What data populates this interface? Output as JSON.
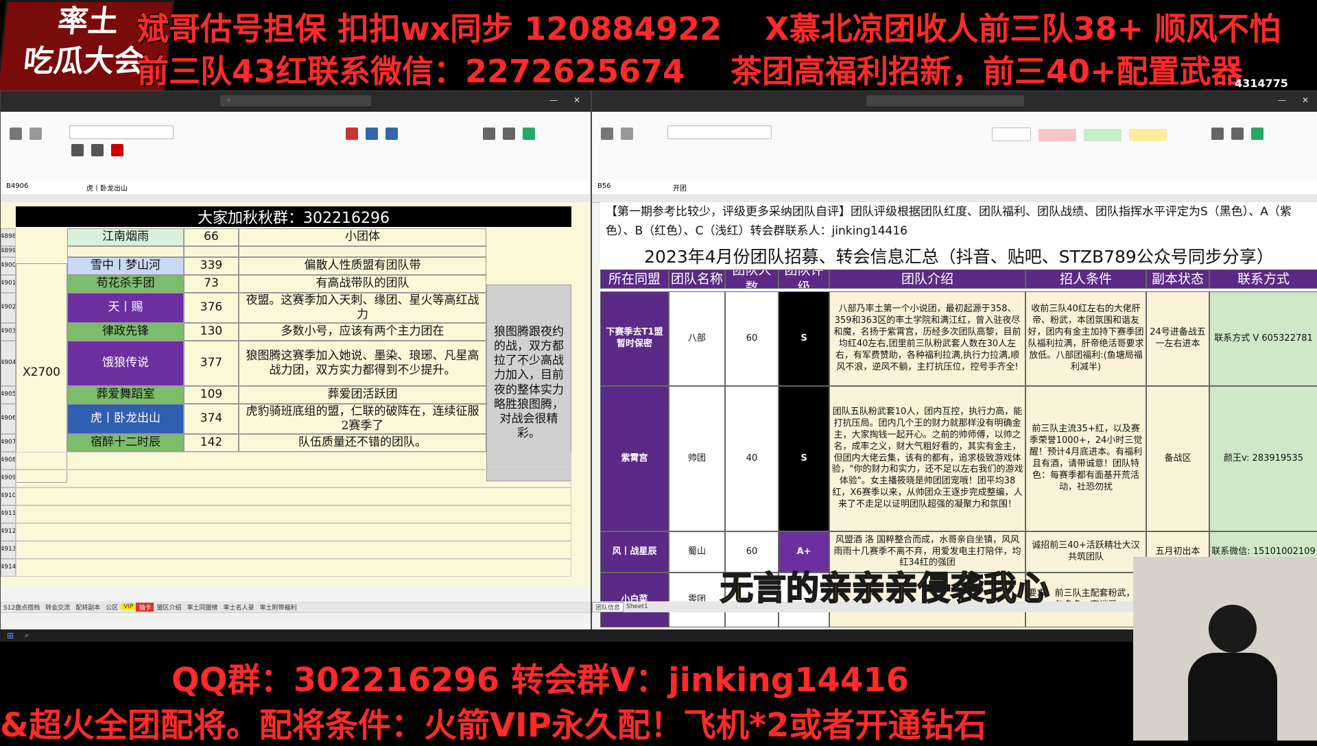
{
  "banner": {
    "line1_a": "斌哥估号担保 扣扣wx同步 120884922",
    "line1_b": "X慕北凉团收人前三队38+  顺风不怕",
    "line2_a": "前三队43红联系微信：2272625674",
    "line2_b": "茶团高福利招新，前三40+配置武器"
  },
  "logo": {
    "line1": "率土",
    "line2": "吃瓜大会"
  },
  "stream_counter": "4314775",
  "left_sheet": {
    "title": "大家加秋秋群：302216296",
    "name_box": "B4906",
    "formula": "虎丨卧龙出山",
    "group_label": "X2700",
    "rows": [
      {
        "row": "4898",
        "name": "江南烟雨",
        "count": "66",
        "desc": "小团体",
        "name_color": "#d9f0d9"
      },
      {
        "row": "4899",
        "name": "",
        "count": "",
        "desc": "",
        "name_color": ""
      },
      {
        "row": "4900",
        "name": "雪中丨梦山河",
        "count": "339",
        "desc": "偏散人性质盟有团队带",
        "name_color": "#c9d8f5"
      },
      {
        "row": "4901",
        "name": "苟花杀手团",
        "count": "73",
        "desc": "有高战带队的团队",
        "name_color": "#7cbc6a"
      },
      {
        "row": "4902",
        "name": "天丨赐",
        "count": "376",
        "desc": "夜盟。这赛季加入天刺、缘团、星火等高红战力",
        "name_color": "#6b2fa0"
      },
      {
        "row": "4903",
        "name": "律政先锋",
        "count": "130",
        "desc": "多数小号，应该有两个主力团在",
        "name_color": "#7cbc6a"
      },
      {
        "row": "4904",
        "name": "饿狼传说",
        "count": "377",
        "desc": "狼图腾这赛季加入她说、墨染、琅琊、凡星高战力团，双方实力都得到不少提升。",
        "name_color": "#6b2fa0"
      },
      {
        "row": "4905",
        "name": "葬爱舞蹈室",
        "count": "109",
        "desc": "葬爱团活跃团",
        "name_color": "#7cbc6a"
      },
      {
        "row": "4906",
        "name": "虎丨卧龙出山",
        "count": "374",
        "desc": "虎豹骑班底组的盟，仁联的破阵在，连续征服2赛季了",
        "name_color": "#2f5fb0"
      },
      {
        "row": "4907",
        "name": "宿醉十二时辰",
        "count": "142",
        "desc": "队伍质量还不错的团队。",
        "name_color": "#7cbc6a"
      }
    ],
    "side_note": "狼图腾跟夜约的战，双方都拉了不少高战力加入，目前夜的整体实力略胜狼图腾，对战会很精彩。",
    "empty_rows": [
      "4908",
      "4909",
      "4910",
      "4911",
      "4912",
      "4913",
      "4914"
    ],
    "tabs": [
      "S12盘点搭档",
      "转会交流",
      "配将副本",
      "公区",
      "VIP",
      "抽卡",
      "盟区介绍",
      "率土同盟榜",
      "率土名人录",
      "率土附带福利"
    ]
  },
  "right_sheet": {
    "name_box": "B56",
    "formula": "开团",
    "notice": "【第一期参考比较少，评级更多采纳团队自评】团队评级根据团队红度、团队福利、团队战绩、团队指挥水平评定为S（黑色）、A（紫色）、B（红色）、C（浅红）转会群联系人：jinking14416",
    "title": "2023年4月份团队招募、转会信息汇总（抖音、贴吧、STZB789公众号同步分享）",
    "headers": [
      "所在同盟",
      "团队名称",
      "团队人数",
      "团队评级",
      "团队介绍",
      "招人条件",
      "副本状态",
      "联系方式"
    ],
    "rows": [
      {
        "alliance": "下赛季去T1盟 暂时保密",
        "team": "八部",
        "size": "60",
        "grade": "S",
        "intro": "八部乃率土第一个小说团，最初起源于358、359和363区的率土学院和满江红，曾入驻夜尽和魔，名扬于紫霄宫，历经多次团队高黎，目前均红40左右,团里前三队粉武套人数在30人左右，有军费赞助，各种福利拉满,执行力拉满,顺风不浪，逆风不躺，主打抗压位，控号手齐全!",
        "req": "收前三队40红左右的大佬肝帝、粉武，本团氛围和谐友好，团内有金主加持下赛季团队福利拉满，肝帝绝活哥要求放低。八部团福利:(鱼塘局福利减半)",
        "status": "24号进备战五一左右进本",
        "contact": "联系方式 V 605322781"
      },
      {
        "alliance": "紫霄宫",
        "team": "帅团",
        "size": "40",
        "grade": "S",
        "intro": "团队五队粉武套10人，团内互控，执行力高，能打抗压局。团内几个王的财力就那样没有明确金主，大家掏钱一起开心。之前的帅师傅，以帅之名，成率之义，财大气粗好看的，其实有金主，但团内大佬云集，该有的都有，追求极致游戏体验，\"你的财力和实力，还不足以左右我们的游戏体验\"。女主播筱晓是帅团团宠哦！团平均38红，X6赛季以来，从帅团众王逐步完成整编，人来了不走足以证明团队超强的凝聚力和氛围！",
        "req": "前三队主流35+红，以及赛季荣誉1000+，24小时三觉醒！预计4月底进本。有福利且有酒，请带诚意！团队特色：每赛季都有面基开荒活动，社恐勿扰",
        "status": "备战区",
        "contact": "颜王v: 283919535"
      },
      {
        "alliance": "风丨战星辰",
        "team": "蜀山",
        "size": "60",
        "grade": "A+",
        "intro": "风盟酒 洛 国粹整合而成，水哥亲自坐镇，风风雨雨十几赛季不离不弃，用爱发电主打陪伴，均红34红的强团",
        "req": "诚招前三40+活跃精壮大汉共筑团队",
        "status": "五月初出本",
        "contact": "联系微信: 15101002109"
      },
      {
        "alliance": "小白菜",
        "team": "零团",
        "size": "",
        "grade": "",
        "intro": "",
        "req": "要求，前三队主配套粉武，红包多多，高端局",
        "status": "",
        "contact": ""
      }
    ],
    "tabs": [
      "团队信息",
      "Sheet1"
    ]
  },
  "overlay_caption": "无言的亲亲亲侵袭我心",
  "bottom": {
    "line1_a": "QQ群：302216296",
    "line1_b": "转会群V：jinking14416",
    "line2": "&超火全团配将。配将条件：火箭VIP永久配！飞机*2或者开通钻石"
  },
  "colors": {
    "banner_red": "#ff2a2a",
    "banner_yellow": "#ffe600",
    "purple": "#5b2a86"
  }
}
